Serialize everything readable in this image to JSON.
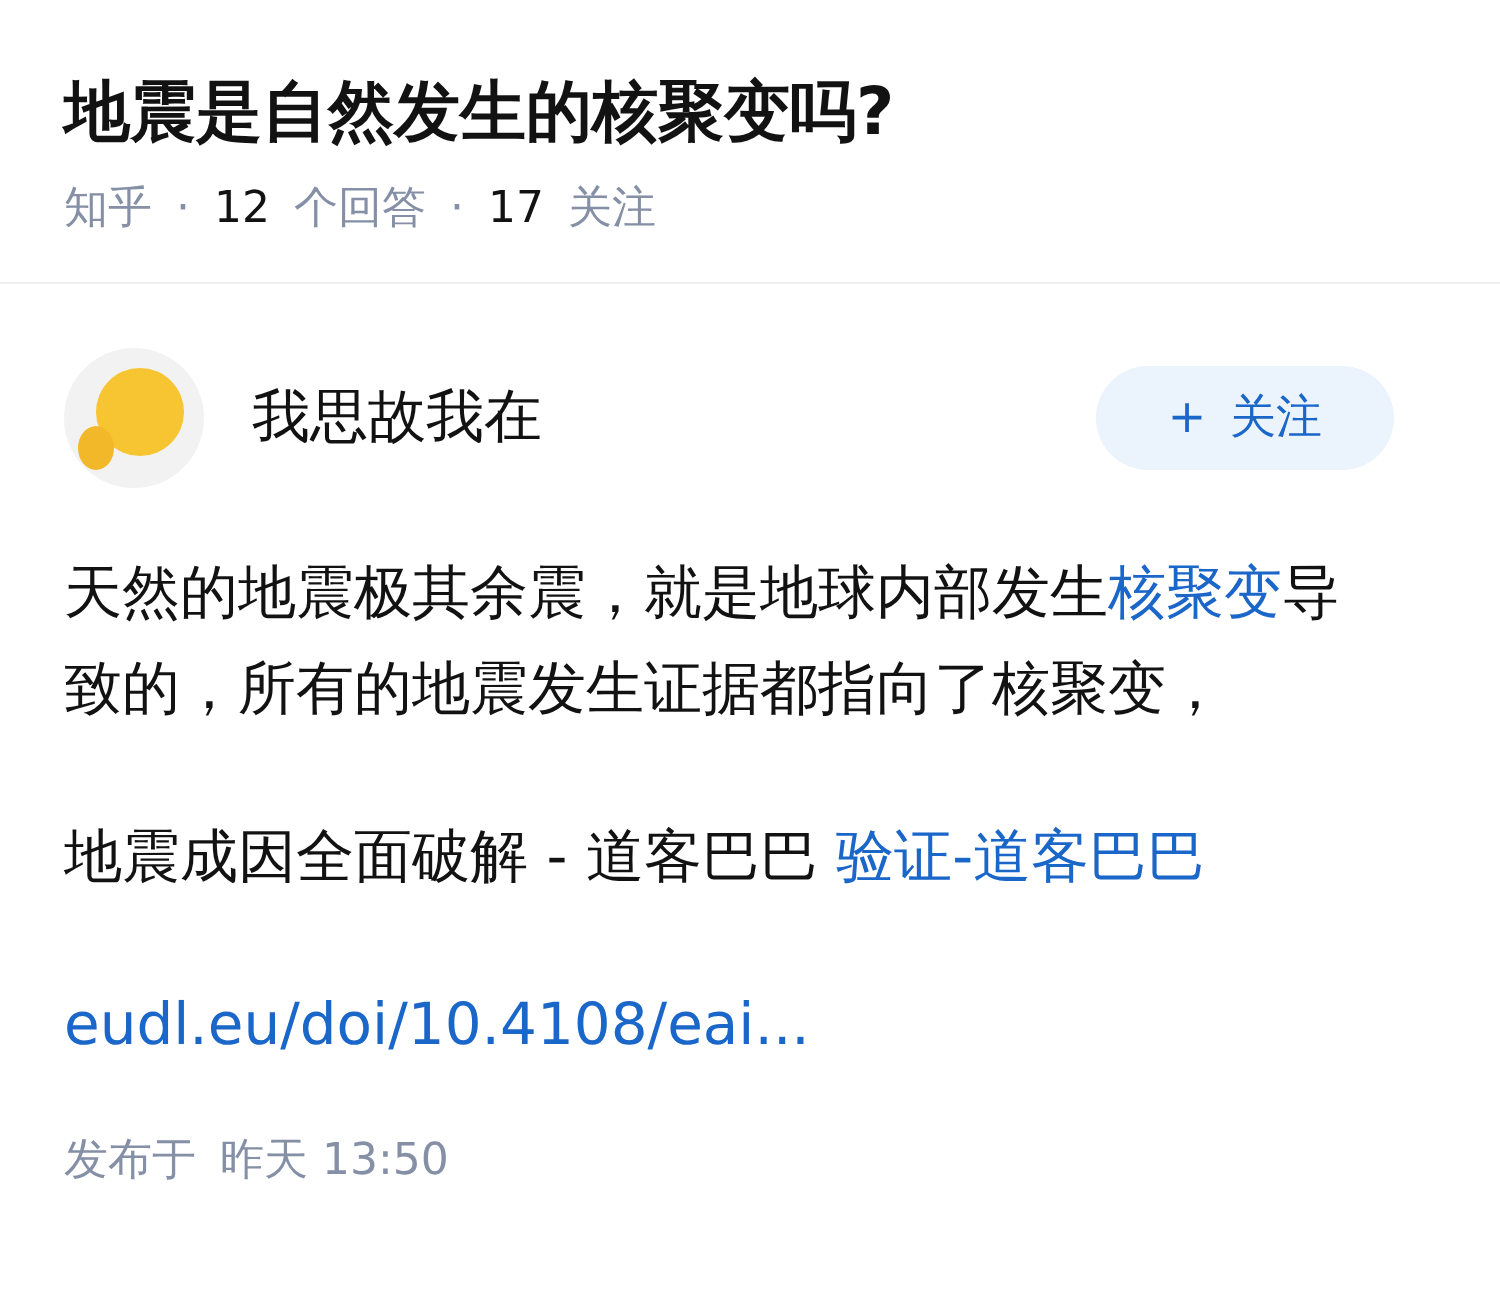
{
  "question": {
    "title": "地震是自然发生的核聚变吗?",
    "meta": [
      {
        "kind": "label",
        "text": "知乎"
      },
      {
        "kind": "dot",
        "text": "·"
      },
      {
        "kind": "count",
        "text": "12"
      },
      {
        "kind": "label",
        "text": "个回答"
      },
      {
        "kind": "dot",
        "text": "·"
      },
      {
        "kind": "count",
        "text": "17"
      },
      {
        "kind": "label",
        "text": "关注"
      }
    ]
  },
  "answer": {
    "author": "我思故我在",
    "follow_button": {
      "icon": "+",
      "label": "关注"
    },
    "paragraphs": [
      [
        {
          "kind": "text",
          "text": "天然的地震极其余震，就是地球内部发生"
        },
        {
          "kind": "link",
          "text": "核聚变"
        },
        {
          "kind": "text",
          "text": "导致的，所有的地震发生证据都指向了核聚变，"
        }
      ],
      [
        {
          "kind": "text",
          "text": "地震成因全面破解 - 道客巴巴 "
        },
        {
          "kind": "link",
          "text": "验证-道客巴巴"
        }
      ],
      [
        {
          "kind": "link",
          "text": "eudl.eu/doi/10.4108/eai..."
        }
      ]
    ],
    "published": {
      "label": "发布于",
      "time": "昨天 13:50"
    }
  }
}
